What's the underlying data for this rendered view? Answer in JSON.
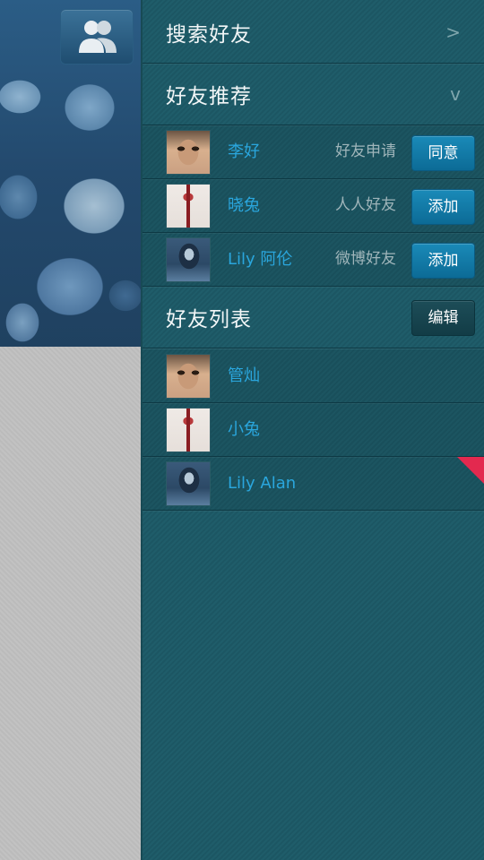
{
  "search": {
    "title": "搜索好友",
    "chevron": ">"
  },
  "recommend": {
    "title": "好友推荐",
    "chevron": "v",
    "items": [
      {
        "name": "李好",
        "source": "好友申请",
        "action": "同意",
        "avatar": "man-avatar"
      },
      {
        "name": "晓兔",
        "source": "人人好友",
        "action": "添加",
        "avatar": "rabbit-avatar"
      },
      {
        "name": "Lily 阿伦",
        "source": "微博好友",
        "action": "添加",
        "avatar": "girl-avatar"
      }
    ]
  },
  "friends": {
    "title": "好友列表",
    "edit_label": "编辑",
    "items": [
      {
        "name": "管灿",
        "avatar": "man-avatar"
      },
      {
        "name": "小兔",
        "avatar": "rabbit-avatar"
      },
      {
        "name": "Lily Alan",
        "avatar": "girl-avatar"
      }
    ]
  },
  "colors": {
    "panel_bg": "#1f5d6a",
    "name_text": "#2aa6dd",
    "button_blue": "#1a8ab8",
    "flag": "#e3294f"
  },
  "icons": {
    "contacts_toggle": "contacts-icon"
  }
}
